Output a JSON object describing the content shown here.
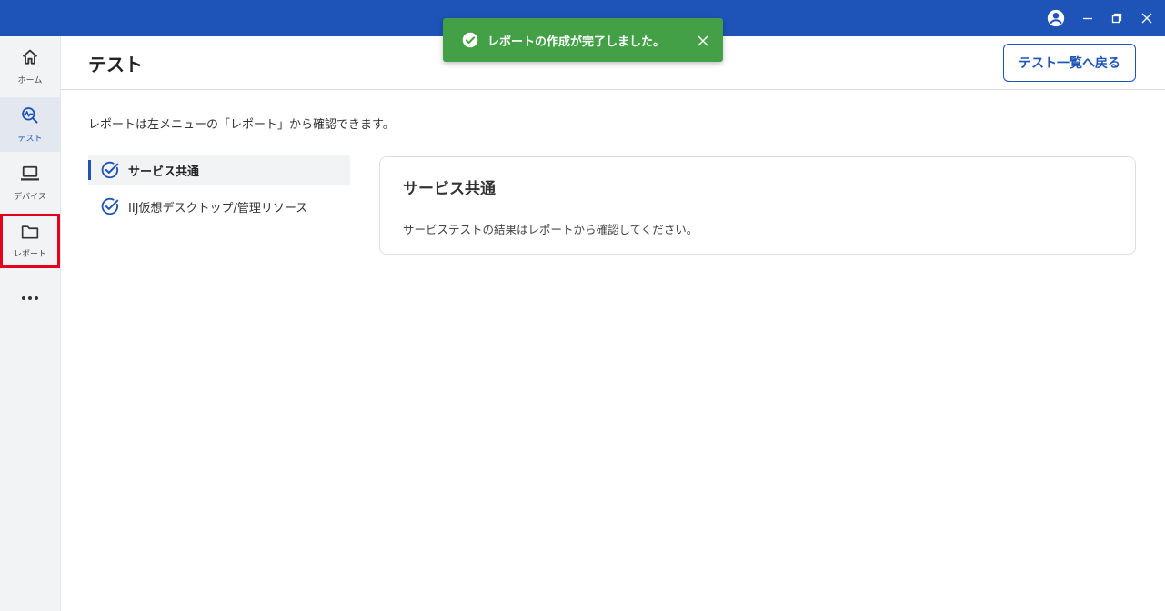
{
  "colors": {
    "titlebar": "#1e54b7",
    "accent": "#1e54b7",
    "toast": "#43a047",
    "highlight": "#e5001b"
  },
  "titlebar": {
    "icons": [
      "account-circle-icon",
      "minimize-icon",
      "restore-icon",
      "close-icon"
    ]
  },
  "sidebar": {
    "items": [
      {
        "label": "ホーム",
        "icon": "home-icon"
      },
      {
        "label": "テスト",
        "icon": "test-analytics-icon",
        "active": true
      },
      {
        "label": "デバイス",
        "icon": "laptop-icon"
      },
      {
        "label": "レポート",
        "icon": "folder-icon",
        "highlighted": true
      }
    ],
    "more_icon": "more-horizontal-icon"
  },
  "header": {
    "title": "テスト",
    "back_label": "テスト一覧へ戻る"
  },
  "note": "レポートは左メニューの「レポート」から確認できます。",
  "steps": [
    {
      "label": "サービス共通",
      "status": "completed",
      "active": true
    },
    {
      "label": "IIJ仮想デスクトップ/管理リソース",
      "status": "completed",
      "active": false
    }
  ],
  "card": {
    "title": "サービス共通",
    "body": "サービステストの結果はレポートから確認してください。"
  },
  "toast": {
    "message": "レポートの作成が完了しました。",
    "icon": "check-circle-icon",
    "close_icon": "close-icon"
  }
}
